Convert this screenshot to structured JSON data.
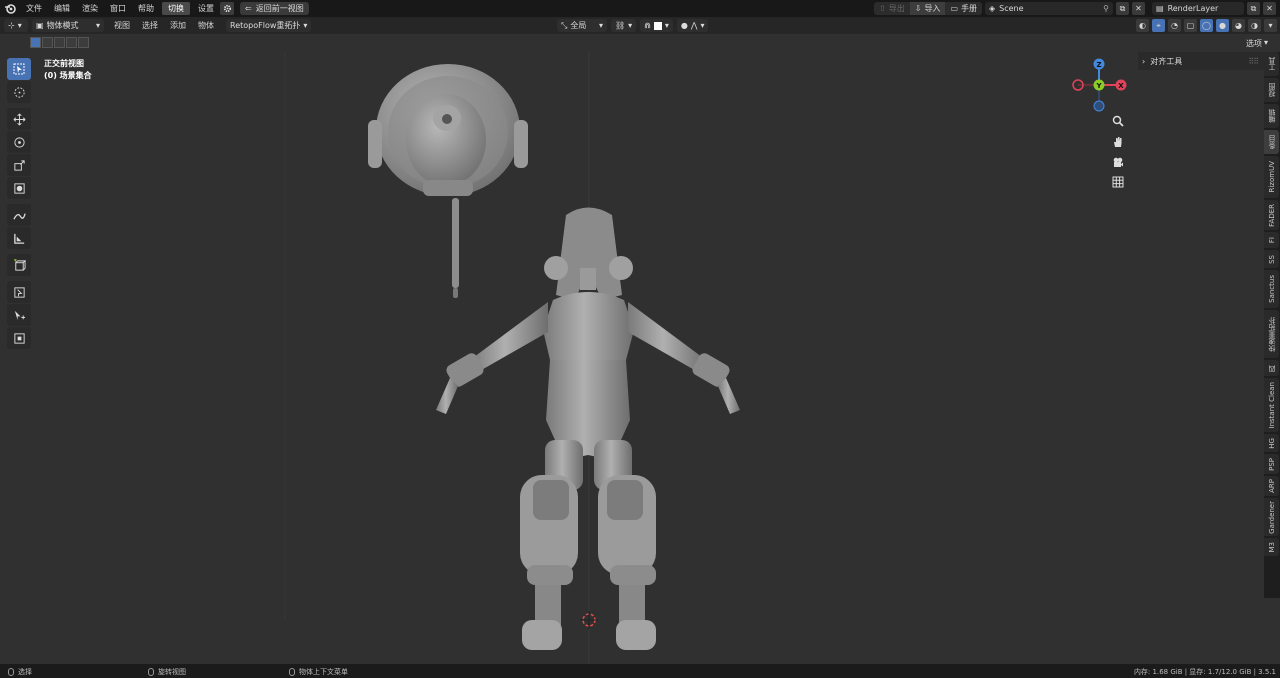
{
  "topbar": {
    "menus": [
      "文件",
      "编辑",
      "渲染",
      "窗口",
      "帮助"
    ],
    "active_menu": "切换",
    "settings_label": "设置",
    "back_label": "返回前一视图",
    "export_label": "导出",
    "import_label": "导入",
    "manual_label": "手册",
    "scene_name": "Scene",
    "render_layer": "RenderLayer"
  },
  "header": {
    "mode": "物体模式",
    "menus": [
      "视图",
      "选择",
      "添加",
      "物体"
    ],
    "retopo": "RetopoFlow重拓扑",
    "transform_orientation": "全局",
    "options_label": "选项"
  },
  "viewport": {
    "view_name": "正交前视图",
    "collection": "(0) 场景集合",
    "gizmo": {
      "z": "Z",
      "y": "Y",
      "x": "X"
    }
  },
  "npanel": {
    "panel_title": "对齐工具"
  },
  "tabs": [
    "工具",
    "视图",
    "编辑",
    "条目",
    "RizomUV",
    "FADER",
    "FI",
    "SS",
    "Sanctus",
    "快速重拓扑",
    "四",
    "Instant Clean",
    "HG",
    "PSP",
    "ARP",
    "Gardener",
    "M3"
  ],
  "active_tab": "条目",
  "status": {
    "left": "选择",
    "middle": "旋转视图",
    "right": "物体上下文菜单",
    "memory": "内存: 1.68 GiB | 显存: 1.7/12.0 GiB | 3.5.1"
  },
  "icons": [
    "blender-logo-icon",
    "gear-icon",
    "select-box-icon",
    "cursor-icon",
    "move-icon",
    "rotate-icon",
    "scale-icon",
    "transform-icon",
    "annotate-icon",
    "measure-icon",
    "add-cube-icon",
    "zoom-icon",
    "hand-icon",
    "camera-icon",
    "grid-icon"
  ],
  "colors": {
    "accent": "#4772b3",
    "x_axis": "#e0435a",
    "y_axis": "#8ccc28",
    "z_axis": "#4389e0",
    "model": "#9a9a9a"
  }
}
